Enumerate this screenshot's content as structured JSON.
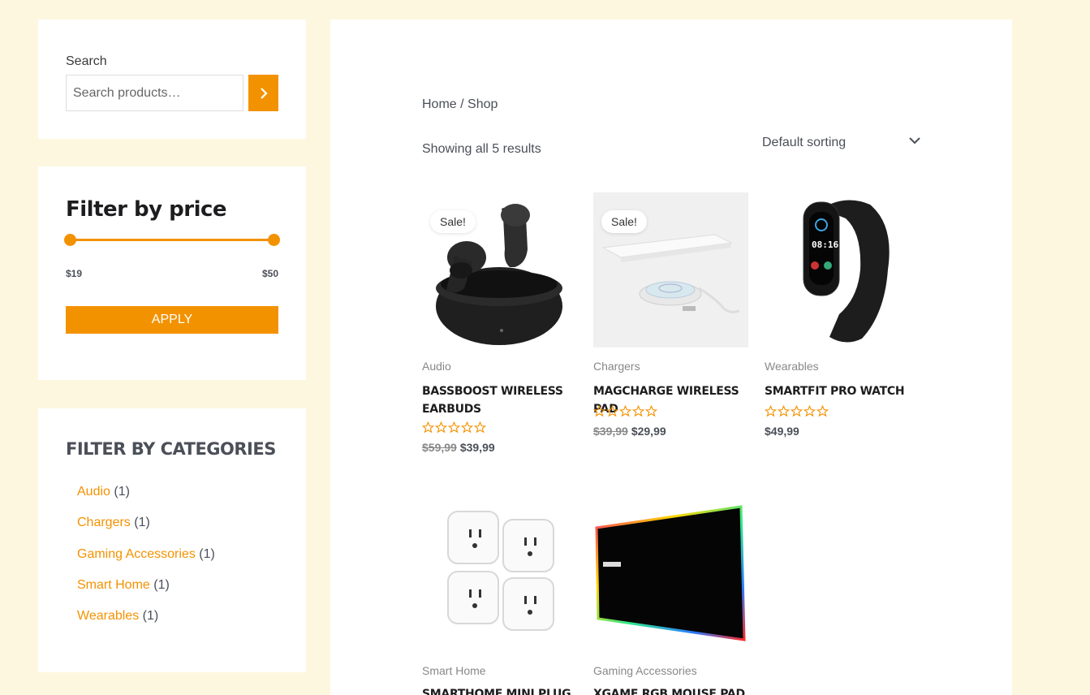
{
  "search": {
    "label": "Search",
    "placeholder": "Search products…"
  },
  "price_filter": {
    "title": "Filter by price",
    "min": "$19",
    "max": "$50",
    "apply": "APPLY"
  },
  "categories": {
    "title": "FILTER BY CATEGORIES",
    "items": [
      {
        "name": "Audio",
        "count": "(1)"
      },
      {
        "name": "Chargers",
        "count": "(1)"
      },
      {
        "name": "Gaming Accessories",
        "count": "(1)"
      },
      {
        "name": "Smart Home",
        "count": "(1)"
      },
      {
        "name": "Wearables",
        "count": "(1)"
      }
    ]
  },
  "shop": {
    "breadcrumb": "Home / Shop",
    "result_count": "Showing all 5 results",
    "sorting": "Default sorting"
  },
  "products": [
    {
      "category": "Audio",
      "title": "BASSBOOST WIRELESS EARBUDS",
      "sale": "Sale!",
      "old_price": "$59,99",
      "price": "$39,99"
    },
    {
      "category": "Chargers",
      "title": "MAGCHARGE WIRELESS PAD",
      "sale": "Sale!",
      "old_price": "$39,99",
      "price": "$29,99"
    },
    {
      "category": "Wearables",
      "title": "SMARTFIT PRO WATCH",
      "price": "$49,99"
    },
    {
      "category": "Smart Home",
      "title": "SMARTHOME MINI PLUG"
    },
    {
      "category": "Gaming Accessories",
      "title": "XGAME RGB MOUSE PAD"
    }
  ],
  "colors": {
    "accent": "#f39200",
    "background": "#fdf7df"
  }
}
